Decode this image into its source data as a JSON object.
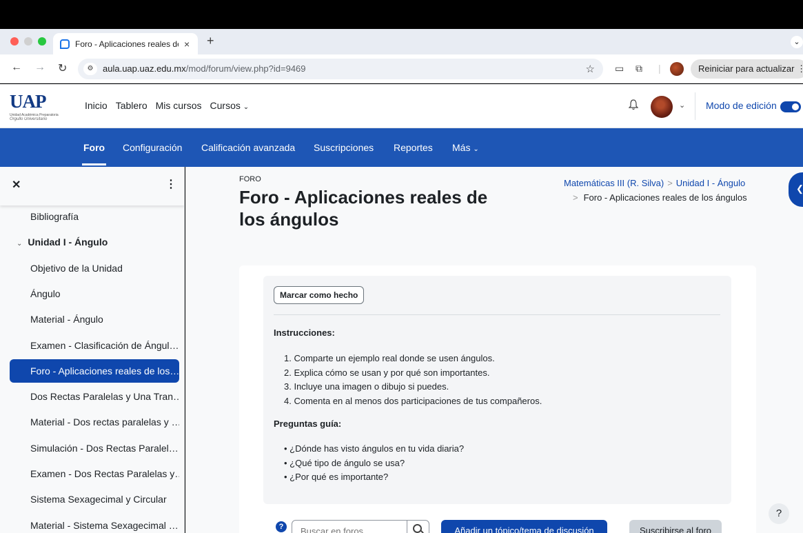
{
  "browser": {
    "tab_title": "Foro - Aplicaciones reales de los ángulos",
    "new_tab_label": "+",
    "url_host": "aula.uap.uaz.edu.mx",
    "url_path": "/mod/forum/view.php?id=9469",
    "relaunch_label": "Reiniciar para actualizar"
  },
  "header": {
    "logo_text": "UAP",
    "logo_subtitle": "Unidad Académica Preparatoria",
    "logo_signature": "Orgullo Universitario",
    "nav": [
      "Inicio",
      "Tablero",
      "Mis cursos",
      "Cursos"
    ],
    "edit_mode_label": "Modo de edición",
    "edit_mode_on": true
  },
  "secondary_nav": {
    "items": [
      "Foro",
      "Configuración",
      "Calificación avanzada",
      "Suscripciones",
      "Reportes",
      "Más"
    ],
    "active": "Foro"
  },
  "course_index": {
    "items": [
      {
        "label": "Bibliografía",
        "type": "activity"
      },
      {
        "label": "Unidad I - Ángulo",
        "type": "section"
      },
      {
        "label": "Objetivo de la Unidad",
        "type": "activity"
      },
      {
        "label": "Ángulo",
        "type": "activity"
      },
      {
        "label": "Material - Ángulo",
        "type": "activity"
      },
      {
        "label": "Examen - Clasificación de Ángul…",
        "type": "activity"
      },
      {
        "label": "Foro - Aplicaciones reales de los…",
        "type": "activity",
        "active": true
      },
      {
        "label": "Dos Rectas Paralelas y Una Tran…",
        "type": "activity"
      },
      {
        "label": "Material - Dos rectas paralelas y …",
        "type": "activity"
      },
      {
        "label": "Simulación - Dos Rectas Paralel…",
        "type": "activity"
      },
      {
        "label": "Examen - Dos Rectas Paralelas y…",
        "type": "activity"
      },
      {
        "label": "Sistema Sexagecimal y Circular",
        "type": "activity"
      },
      {
        "label": "Material - Sistema Sexagecimal …",
        "type": "activity"
      }
    ]
  },
  "page": {
    "activity_type": "FORO",
    "title": "Foro - Aplicaciones reales de los ángulos",
    "breadcrumb": [
      "Matemáticas III (R. Silva)",
      "Unidad I - Ángulo",
      "Foro - Aplicaciones reales de los ángulos"
    ],
    "mark_done_label": "Marcar como hecho",
    "instructions_heading": "Instrucciones:",
    "instructions": [
      "Comparte un ejemplo real donde se usen ángulos.",
      "Explica cómo se usan y por qué son importantes.",
      "Incluye una imagen o dibujo si puedes.",
      "Comenta en al menos dos participaciones de tus compañeros."
    ],
    "guide_heading": "Preguntas guía:",
    "guide_questions": [
      "¿Dónde has visto ángulos en tu vida diaria?",
      "¿Qué tipo de ángulo se usa?",
      "¿Por qué es importante?"
    ],
    "search_placeholder": "Buscar en foros",
    "add_topic_label": "Añadir un tópico/tema de discusión",
    "subscribe_label": "Suscribirse al foro",
    "help_label": "?"
  },
  "colors": {
    "brand_blue": "#0f47ad",
    "secondary_nav_bg": "#1e56b5",
    "drawer_bg": "#f8f9fa"
  }
}
